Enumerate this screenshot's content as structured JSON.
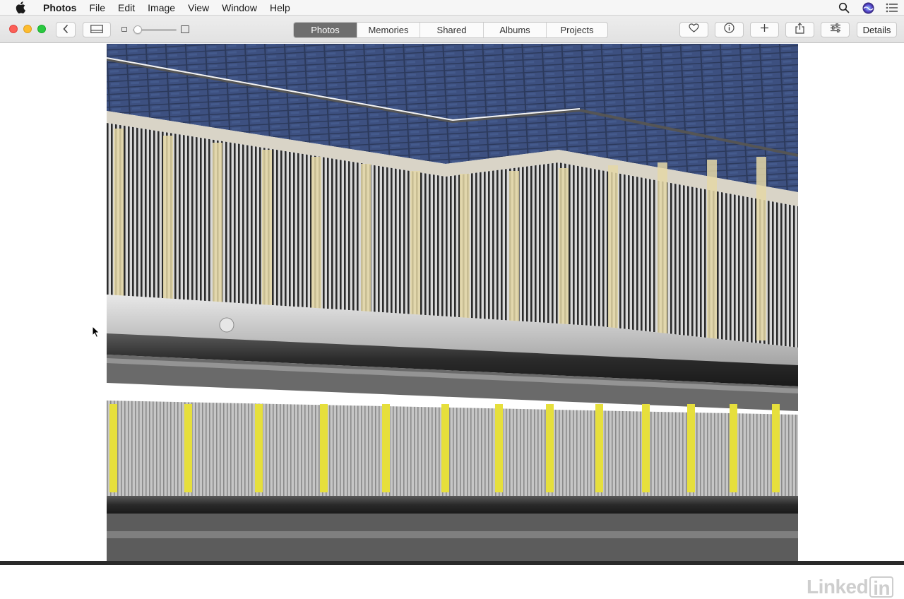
{
  "menubar": {
    "apple_icon": "apple-logo-icon",
    "app_name": "Photos",
    "menus": [
      "File",
      "Edit",
      "Image",
      "View",
      "Window",
      "Help"
    ],
    "right_icons": [
      "spotlight-search-icon",
      "siri-icon",
      "notification-center-icon"
    ]
  },
  "toolbar": {
    "back_icon": "chevron-left-icon",
    "sidebar_icon": "sidebar-toggle-icon",
    "zoom_level": 0.05,
    "tabs": [
      "Photos",
      "Memories",
      "Shared",
      "Albums",
      "Projects"
    ],
    "active_tab": "Photos",
    "action_icons": [
      "heart-icon",
      "info-icon",
      "plus-icon",
      "share-icon",
      "adjust-sliders-icon"
    ],
    "details_label": "Details"
  },
  "viewer": {
    "photo_description_icon": "escalator-photo"
  },
  "watermark": {
    "text_linked": "Linked",
    "text_in": "in"
  },
  "colors": {
    "active_tab_bg": "#6e6e6e",
    "traffic_red": "#fc5f57",
    "traffic_yellow": "#fdbc2e",
    "traffic_green": "#29c840"
  }
}
